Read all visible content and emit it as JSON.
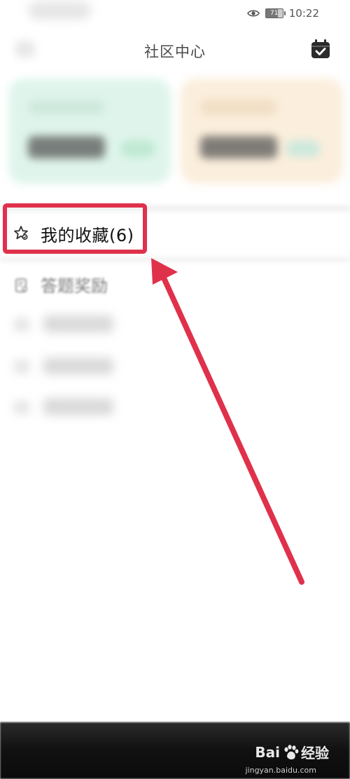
{
  "status_bar": {
    "battery_level": "71",
    "time": "10:22",
    "icons": [
      "eye-icon",
      "battery-icon"
    ]
  },
  "header": {
    "title": "社区中心",
    "right_icon": "calendar-check-icon"
  },
  "menu": {
    "favorites": {
      "label": "我的收藏(6)",
      "icon": "star-icon"
    },
    "quiz_rewards": {
      "label": "答题奖励",
      "icon": "document-icon"
    }
  },
  "annotation": {
    "highlight_color": "#e0314b"
  },
  "watermark": {
    "brand": "Bai",
    "brand_suffix": "经验",
    "url": "jingyan.baidu.com",
    "icon": "baidu-paw-icon"
  }
}
